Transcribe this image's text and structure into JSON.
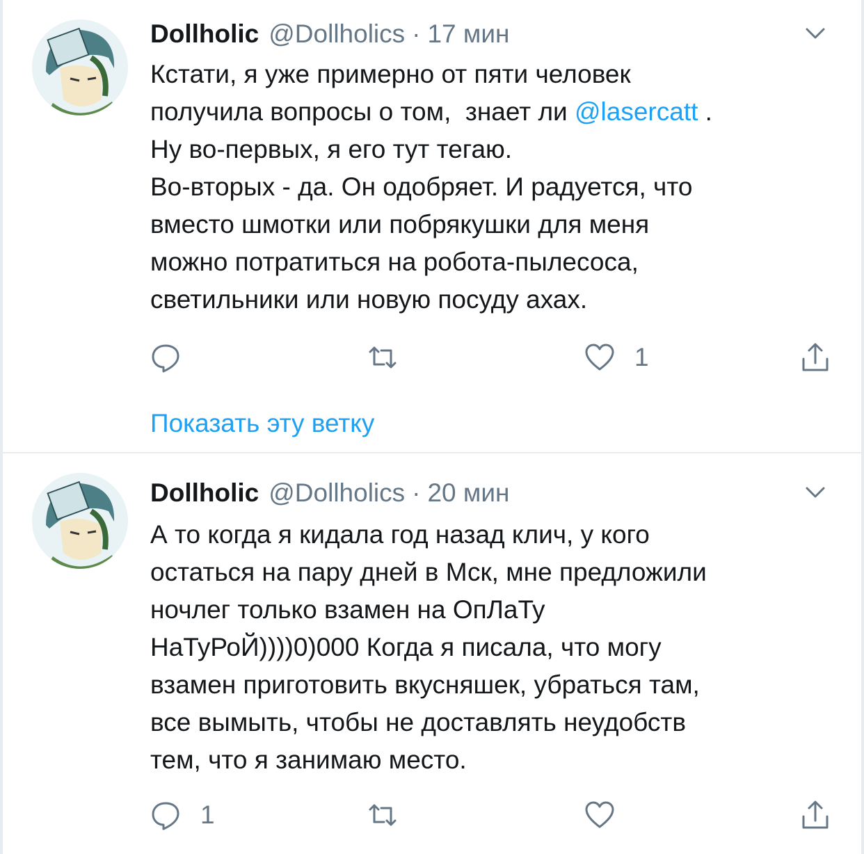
{
  "tweets": [
    {
      "name": "Dollholic",
      "handle": "@Dollholics",
      "separator": "·",
      "time": "17 мин",
      "text_before_mention": "Кстати, я уже примерно от пяти человек\nполучила вопросы о том,  знает ли ",
      "mention": "@lasercatt",
      "text_after_mention": " .\nНу во-первых, я его тут тегаю.\nВо-вторых - да. Он одобряет. И радуется, что\nвместо шмотки или побрякушки для меня\nможно потратиться на робота-пылесоса,\nсветильники или новую посуду ахах.",
      "reply_count": "",
      "retweet_count": "",
      "like_count": "1",
      "show_thread": "Показать эту ветку"
    },
    {
      "name": "Dollholic",
      "handle": "@Dollholics",
      "separator": "·",
      "time": "20 мин",
      "text": "А то когда я кидала год назад клич, у кого\nостаться на пару дней в Мск, мне предложили\nночлег только взамен на ОпЛаТу\nНаТуРоЙ))))0)000 Когда я писала, что могу\nвзамен приготовить вкусняшек, убраться там,\nвсе вымыть, чтобы не доставлять неудобств\nтем, что я занимаю место.",
      "reply_count": "1",
      "retweet_count": "",
      "like_count": ""
    }
  ],
  "icons": {
    "reply": "reply-bubble-icon",
    "retweet": "retweet-icon",
    "like": "heart-icon",
    "share": "share-icon",
    "menu": "chevron-down-icon"
  },
  "colors": {
    "text": "#14171a",
    "muted": "#657786",
    "link": "#1da1f2",
    "divider": "#e6ecf0"
  }
}
